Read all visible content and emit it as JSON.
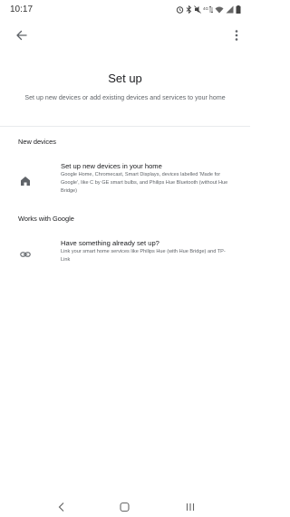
{
  "status_bar": {
    "time": "10:17",
    "icons": [
      "alarm-icon",
      "bluetooth-icon",
      "mute-icon",
      "data-icon",
      "wifi-icon",
      "signal-icon",
      "battery-icon"
    ]
  },
  "app_bar": {
    "back_icon": "arrow-back-icon",
    "more_icon": "more-vert-icon"
  },
  "page": {
    "title": "Set up",
    "subtitle": "Set up new devices or add existing devices and services to your home"
  },
  "sections": [
    {
      "header": "New devices",
      "items": [
        {
          "icon": "home-icon",
          "title": "Set up new devices in your home",
          "description": "Google Home, Chromecast, Smart Displays, devices labelled 'Made for Google', like C by GE smart bulbs, and Philips Hue Bluetooth (without Hue Bridge)"
        }
      ]
    },
    {
      "header": "Works with Google",
      "items": [
        {
          "icon": "link-icon",
          "title": "Have something already set up?",
          "description": "Link your smart home services like Philips Hue (with Hue Bridge) and TP-Link"
        }
      ]
    }
  ],
  "nav_bar": {
    "back_icon": "nav-back-icon",
    "home_icon": "nav-home-icon",
    "recents_icon": "nav-recents-icon"
  },
  "colors": {
    "background": "#ffffff",
    "text_primary": "#202124",
    "text_secondary": "#5f6368",
    "icon": "#5f6368"
  }
}
